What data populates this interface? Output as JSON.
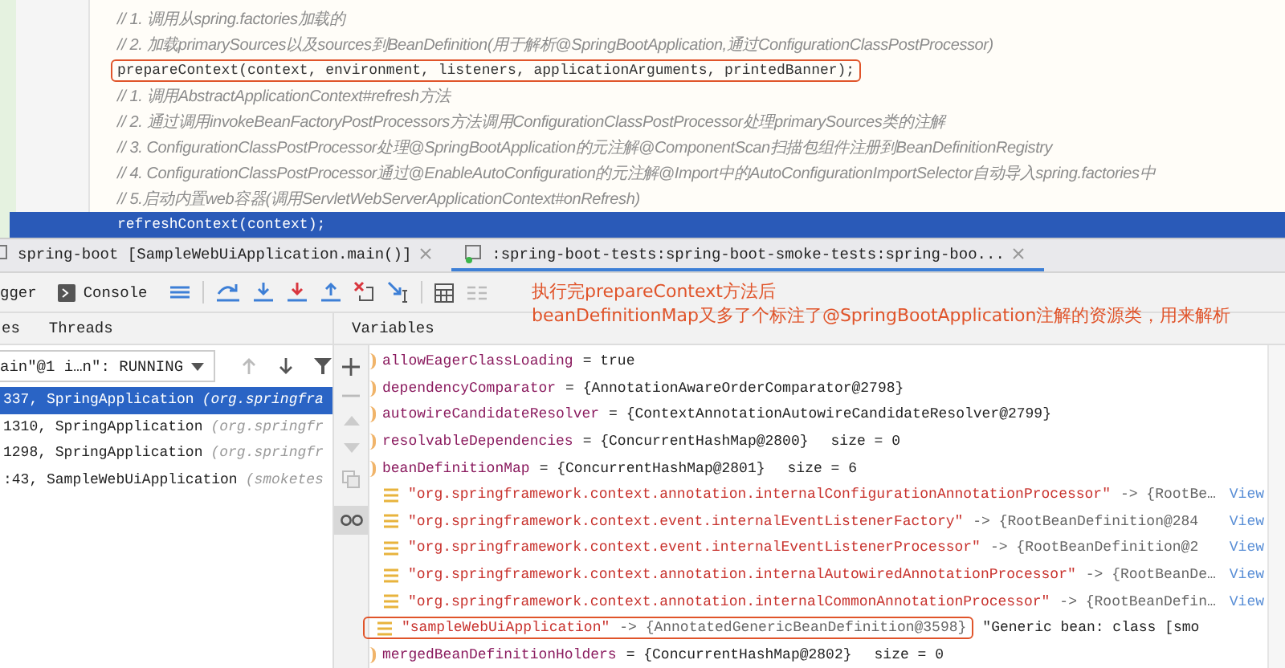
{
  "editor": {
    "lines": [
      {
        "kind": "comment",
        "text": "// 1. 调用从spring.factories加载的",
        "selected": false,
        "boxed": false
      },
      {
        "kind": "comment",
        "text": "// 2. 加载primarySources以及sources到BeanDefinition(用于解析@SpringBootApplication,通过ConfigurationClassPostProcessor)",
        "selected": false,
        "boxed": false
      },
      {
        "kind": "code",
        "text": "prepareContext(context, environment, listeners, applicationArguments, printedBanner);",
        "selected": false,
        "boxed": true
      },
      {
        "kind": "comment",
        "text": "// 1. 调用AbstractApplicationContext#refresh方法",
        "selected": false,
        "boxed": false
      },
      {
        "kind": "comment",
        "text": "// 2. 通过调用invokeBeanFactoryPostProcessors方法调用ConfigurationClassPostProcessor处理primarySources类的注解",
        "selected": false,
        "boxed": false
      },
      {
        "kind": "comment",
        "text": "// 3. ConfigurationClassPostProcessor处理@SpringBootApplication的元注解@ComponentScan扫描包组件注册到BeanDefinitionRegistry",
        "selected": false,
        "boxed": false
      },
      {
        "kind": "comment",
        "text": "// 4. ConfigurationClassPostProcessor通过@EnableAutoConfiguration的元注解@Import中的AutoConfigurationImportSelector自动导入spring.factories中",
        "selected": false,
        "boxed": false
      },
      {
        "kind": "comment",
        "text": "// 5.启动内置web容器(调用ServletWebServerApplicationContext#onRefresh)",
        "selected": false,
        "boxed": false
      },
      {
        "kind": "code",
        "text": "refreshContext(context);",
        "selected": true,
        "boxed": false
      }
    ]
  },
  "session_tabs": [
    {
      "label": "spring-boot [SampleWebUiApplication.main()]",
      "selected": false
    },
    {
      "label": ":spring-boot-tests:spring-boot-smoke-tests:spring-boo...",
      "selected": true
    }
  ],
  "toolbar": {
    "tabs": [
      "gger",
      "Console"
    ]
  },
  "annotation": [
    "执行完prepareContext方法后",
    "beanDefinitionMap又多了个标注了@SpringBootApplication注解的资源类，用来解析"
  ],
  "frames_panel": {
    "headers": [
      "es",
      "Threads"
    ],
    "thread": "ain\"@1 i…n\": RUNNING",
    "frames": [
      {
        "line": "337, SpringApplication",
        "location": "(org.springfra",
        "selected": true
      },
      {
        "line": "1310, SpringApplication",
        "location": "(org.springfr",
        "selected": false
      },
      {
        "line": "1298, SpringApplication",
        "location": "(org.springfr",
        "selected": false
      },
      {
        "line": ":43, SampleWebUiApplication",
        "location": "(smoketes",
        "selected": false
      }
    ]
  },
  "variables_panel": {
    "header": "Variables",
    "items": [
      {
        "kind": "field",
        "name": "allowEagerClassLoading",
        "value": "= true"
      },
      {
        "kind": "field",
        "name": "dependencyComparator",
        "value": "= {AnnotationAwareOrderComparator@2798}"
      },
      {
        "kind": "field",
        "name": "autowireCandidateResolver",
        "value": "= {ContextAnnotationAutowireCandidateResolver@2799}"
      },
      {
        "kind": "field",
        "name": "resolvableDependencies",
        "value": "= {ConcurrentHashMap@2800}",
        "size": "size = 0"
      },
      {
        "kind": "field",
        "name": "beanDefinitionMap",
        "value": "= {ConcurrentHashMap@2801}",
        "size": "size = 6"
      },
      {
        "kind": "entry",
        "key": "\"org.springframework.context.annotation.internalConfigurationAnnotationProcessor\"",
        "value": "-> {RootBe…",
        "link": "View",
        "boxed": false
      },
      {
        "kind": "entry",
        "key": "\"org.springframework.context.event.internalEventListenerFactory\"",
        "value": "-> {RootBeanDefinition@284",
        "link": "View",
        "boxed": false
      },
      {
        "kind": "entry",
        "key": "\"org.springframework.context.event.internalEventListenerProcessor\"",
        "value": "-> {RootBeanDefinition@2",
        "link": "View",
        "boxed": false
      },
      {
        "kind": "entry",
        "key": "\"org.springframework.context.annotation.internalAutowiredAnnotationProcessor\"",
        "value": "-> {RootBeanDe…",
        "link": "View",
        "boxed": false
      },
      {
        "kind": "entry",
        "key": "\"org.springframework.context.annotation.internalCommonAnnotationProcessor\"",
        "value": "-> {RootBeanDefin…",
        "link": "View",
        "boxed": false
      },
      {
        "kind": "entry",
        "key": "\"sampleWebUiApplication\"",
        "value": "-> {AnnotatedGenericBeanDefinition@3598}",
        "note": "\"Generic bean: class [smo",
        "boxed": true
      },
      {
        "kind": "field",
        "name": "mergedBeanDefinitionHolders",
        "value": "= {ConcurrentHashMap@2802}",
        "size": "size = 0"
      }
    ]
  }
}
